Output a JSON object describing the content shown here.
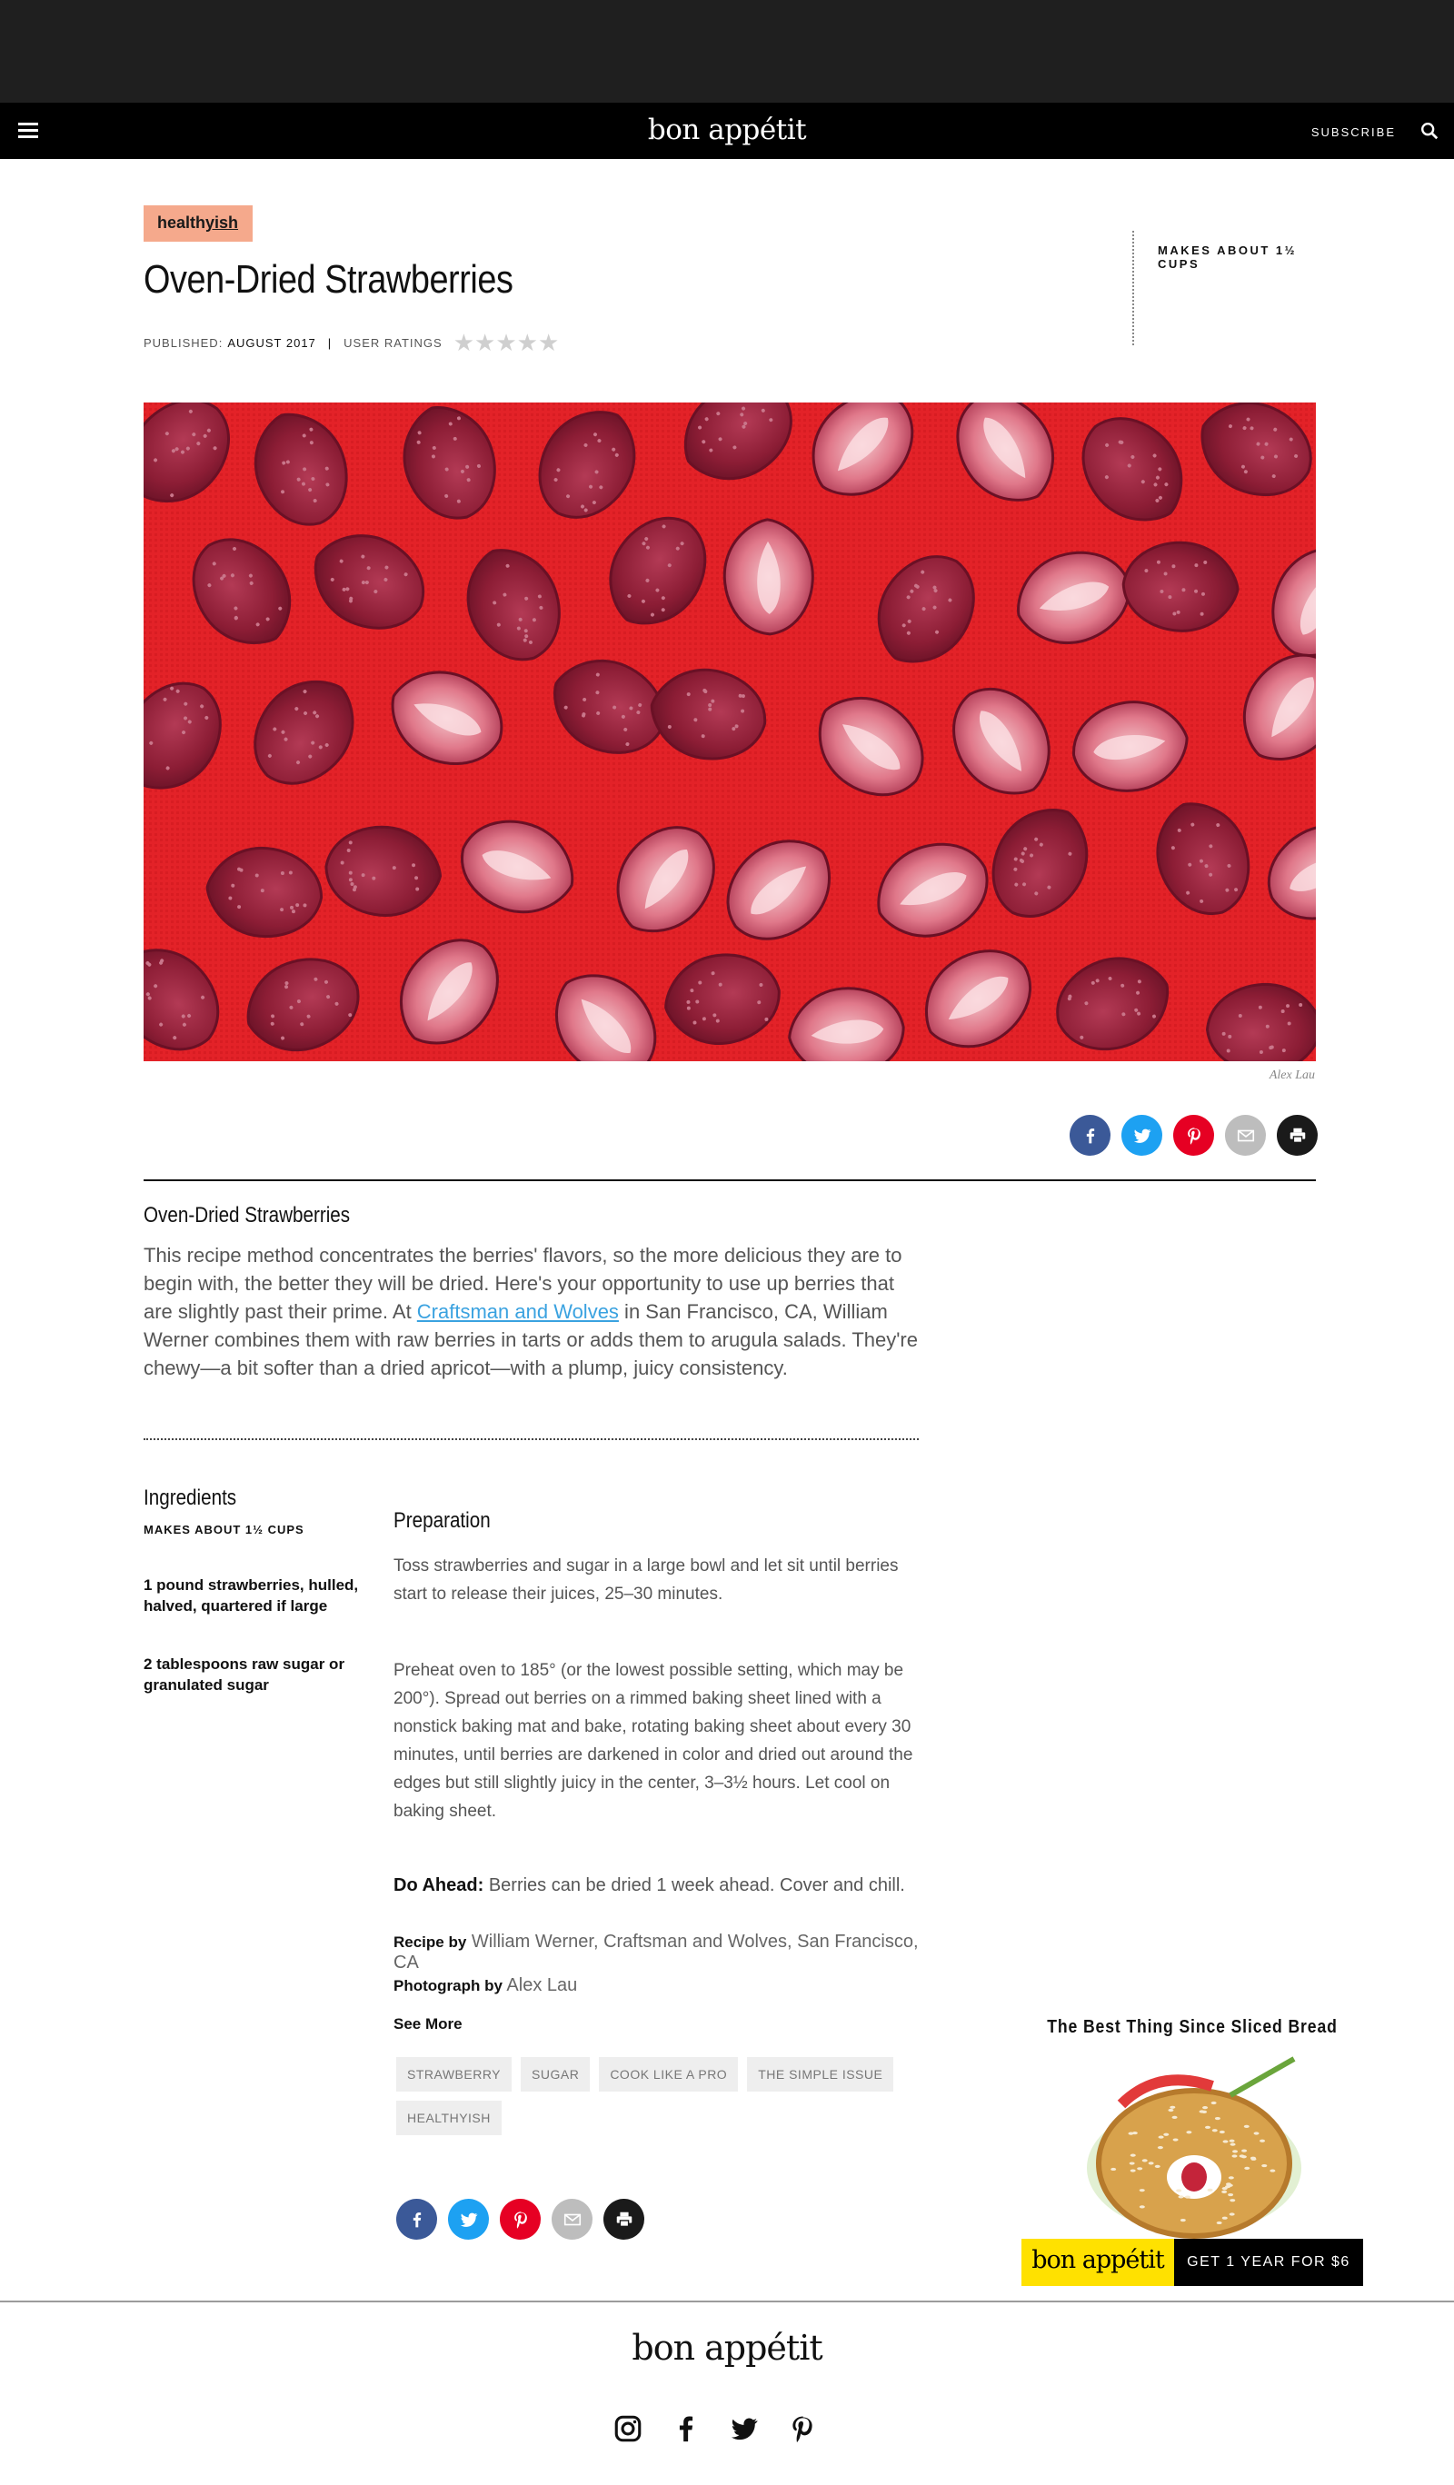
{
  "header": {
    "logo": "bon appétit",
    "subscribe": "SUBSCRIBE",
    "icons": [
      "menu-icon",
      "search-icon"
    ]
  },
  "recipe": {
    "badge_prefix": "health",
    "badge_suffix": "yish",
    "title": "Oven-Dried Strawberries",
    "published_label": "PUBLISHED:",
    "published_date": "AUGUST 2017",
    "separator": "|",
    "ratings_label": "USER RATINGS",
    "stars": "★★★★★",
    "yield_box": "MAKES ABOUT 1½ CUPS",
    "photo_credit": "Alex Lau"
  },
  "share_icons": [
    "facebook-icon",
    "twitter-icon",
    "pinterest-icon",
    "email-icon",
    "print-icon"
  ],
  "intro": {
    "heading": "Oven-Dried Strawberries",
    "text_before": "This recipe method concentrates the berries' flavors, so the more delicious they are to begin with, the better they will be dried. Here's your opportunity to use up berries that are slightly past their prime. At ",
    "link": "Craftsman and Wolves",
    "text_after": " in San Francisco, CA, William Werner combines them with raw berries in tarts or adds them to arugula salads. They're chewy—a bit softer than a dried apricot—with a plump, juicy consistency."
  },
  "ingredients": {
    "heading": "Ingredients",
    "yield": "MAKES ABOUT 1½ CUPS",
    "items": [
      "1 pound strawberries, hulled, halved, quartered if large",
      "2 tablespoons raw sugar or granulated sugar"
    ]
  },
  "preparation": {
    "heading": "Preparation",
    "steps": [
      "Toss strawberries and sugar in a large bowl and let sit until berries start to release their juices, 25–30 minutes.",
      "Preheat oven to 185° (or the lowest possible setting, which may be 200°). Spread out berries on a rimmed baking sheet lined with a nonstick baking mat and bake, rotating baking sheet about every 30 minutes, until berries are darkened in color and dried out around the edges but still slightly juicy in the center, 3–3½ hours. Let cool on baking sheet."
    ],
    "do_ahead_label": "Do Ahead:",
    "do_ahead_text": "Berries can be dried 1 week ahead. Cover and chill.",
    "recipe_by_label": "Recipe by",
    "recipe_by": "William Werner, Craftsman and Wolves, San Francisco, CA",
    "photo_by_label": "Photograph by",
    "photo_by": "Alex Lau",
    "see_more": "See More",
    "tags": [
      "STRAWBERRY",
      "SUGAR",
      "COOK LIKE A PRO",
      "THE SIMPLE ISSUE",
      "HEALTHYISH"
    ]
  },
  "ad": {
    "headline": "The Best Thing Since Sliced Bread",
    "logo": "bon appétit",
    "cta": "GET 1 YEAR FOR $6"
  },
  "footer": {
    "logo": "bon appétit",
    "social_icons": [
      "instagram-icon",
      "facebook-icon",
      "twitter-icon",
      "pinterest-icon"
    ]
  },
  "colors": {
    "badge": "#f5a98c",
    "link": "#3aa2e0",
    "hero_red": "#e32228",
    "ad_yellow": "#ffe100",
    "facebook": "#3b5998",
    "twitter": "#1da1f2",
    "pinterest": "#e60023"
  }
}
